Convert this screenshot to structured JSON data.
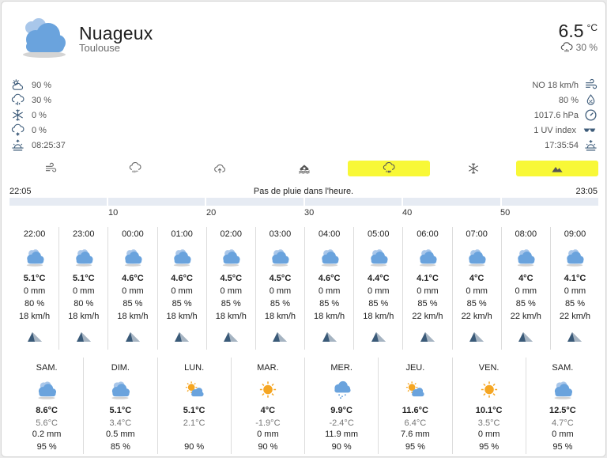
{
  "header": {
    "title": "Nuageux",
    "subtitle": "Toulouse",
    "temperature": "6.5",
    "temperature_unit": "°C",
    "precip_probability": "30 %",
    "main_icon": "cloudy-icon"
  },
  "attributes_left": [
    {
      "icon": "sun-cloud-icon",
      "value": "90 %"
    },
    {
      "icon": "rain-cloud-icon",
      "value": "30 %"
    },
    {
      "icon": "snowflake-icon",
      "value": "0 %"
    },
    {
      "icon": "snow-cloud-icon",
      "value": "0 %"
    },
    {
      "icon": "sunrise-icon",
      "value": "08:25:37"
    }
  ],
  "attributes_right": [
    {
      "icon": "wind-icon",
      "value": "NO 18 km/h"
    },
    {
      "icon": "humidity-drop-icon",
      "value": "80 %"
    },
    {
      "icon": "pressure-gauge-icon",
      "value": "1017.6 hPa"
    },
    {
      "icon": "sunglasses-icon",
      "value": "1 UV index"
    },
    {
      "icon": "sunset-icon",
      "value": "17:35:54"
    }
  ],
  "chart_tabs": [
    {
      "icon": "wind-tab-icon",
      "active": false
    },
    {
      "icon": "rain-tab-icon",
      "active": false
    },
    {
      "icon": "cloud-upload-tab-icon",
      "active": false
    },
    {
      "icon": "home-flood-tab-icon",
      "active": false
    },
    {
      "icon": "weather-snowy-rainy-tab-icon",
      "active": true
    },
    {
      "icon": "snowflake-tab-icon",
      "active": false
    },
    {
      "icon": "mountains-tab-icon",
      "active": true
    }
  ],
  "nowcast": {
    "start": "22:05",
    "message": "Pas de pluie dans l'heure.",
    "end": "23:05",
    "minute_labels": [
      "10",
      "20",
      "30",
      "40",
      "50"
    ]
  },
  "hourly": [
    {
      "time": "22:00",
      "temp": "5.1°C",
      "precip": "0 mm",
      "humidity": "80 %",
      "wind": "18 km/h"
    },
    {
      "time": "23:00",
      "temp": "5.1°C",
      "precip": "0 mm",
      "humidity": "80 %",
      "wind": "18 km/h"
    },
    {
      "time": "00:00",
      "temp": "4.6°C",
      "precip": "0 mm",
      "humidity": "85 %",
      "wind": "18 km/h"
    },
    {
      "time": "01:00",
      "temp": "4.6°C",
      "precip": "0 mm",
      "humidity": "85 %",
      "wind": "18 km/h"
    },
    {
      "time": "02:00",
      "temp": "4.5°C",
      "precip": "0 mm",
      "humidity": "85 %",
      "wind": "18 km/h"
    },
    {
      "time": "03:00",
      "temp": "4.5°C",
      "precip": "0 mm",
      "humidity": "85 %",
      "wind": "18 km/h"
    },
    {
      "time": "04:00",
      "temp": "4.6°C",
      "precip": "0 mm",
      "humidity": "85 %",
      "wind": "18 km/h"
    },
    {
      "time": "05:00",
      "temp": "4.4°C",
      "precip": "0 mm",
      "humidity": "85 %",
      "wind": "18 km/h"
    },
    {
      "time": "06:00",
      "temp": "4.1°C",
      "precip": "0 mm",
      "humidity": "85 %",
      "wind": "22 km/h"
    },
    {
      "time": "07:00",
      "temp": "4°C",
      "precip": "0 mm",
      "humidity": "85 %",
      "wind": "22 km/h"
    },
    {
      "time": "08:00",
      "temp": "4°C",
      "precip": "0 mm",
      "humidity": "85 %",
      "wind": "22 km/h"
    },
    {
      "time": "09:00",
      "temp": "4.1°C",
      "precip": "0 mm",
      "humidity": "85 %",
      "wind": "22 km/h"
    }
  ],
  "daily": [
    {
      "day": "SAM.",
      "icon": "partly-cloudy",
      "high": "8.6°C",
      "low": "5.6°C",
      "precip": "0.2 mm",
      "humidity": "95 %"
    },
    {
      "day": "DIM.",
      "icon": "partly-cloudy",
      "high": "5.1°C",
      "low": "3.4°C",
      "precip": "0.5 mm",
      "humidity": "85 %"
    },
    {
      "day": "LUN.",
      "icon": "sun-cloud",
      "high": "5.1°C",
      "low": "2.1°C",
      "precip": "",
      "humidity": "90 %"
    },
    {
      "day": "MAR.",
      "icon": "sunny",
      "high": "4°C",
      "low": "-1.9°C",
      "precip": "0 mm",
      "humidity": "90 %"
    },
    {
      "day": "MER.",
      "icon": "rain-cloud",
      "high": "9.9°C",
      "low": "-2.4°C",
      "precip": "11.9 mm",
      "humidity": "90 %"
    },
    {
      "day": "JEU.",
      "icon": "sun-cloud",
      "high": "11.6°C",
      "low": "6.4°C",
      "precip": "7.6 mm",
      "humidity": "95 %"
    },
    {
      "day": "VEN.",
      "icon": "sunny",
      "high": "10.1°C",
      "low": "3.5°C",
      "precip": "0 mm",
      "humidity": "95 %"
    },
    {
      "day": "SAM.",
      "icon": "partly-cloudy",
      "high": "12.5°C",
      "low": "4.7°C",
      "precip": "0 mm",
      "humidity": "95 %"
    }
  ],
  "colors": {
    "accent_highlight": "#f8f837",
    "icon_blue": "#6aa3dd",
    "sun": "#f5a623",
    "wind_arrow": "#3a5a78",
    "attribute_icon": "#3e5c7a"
  }
}
